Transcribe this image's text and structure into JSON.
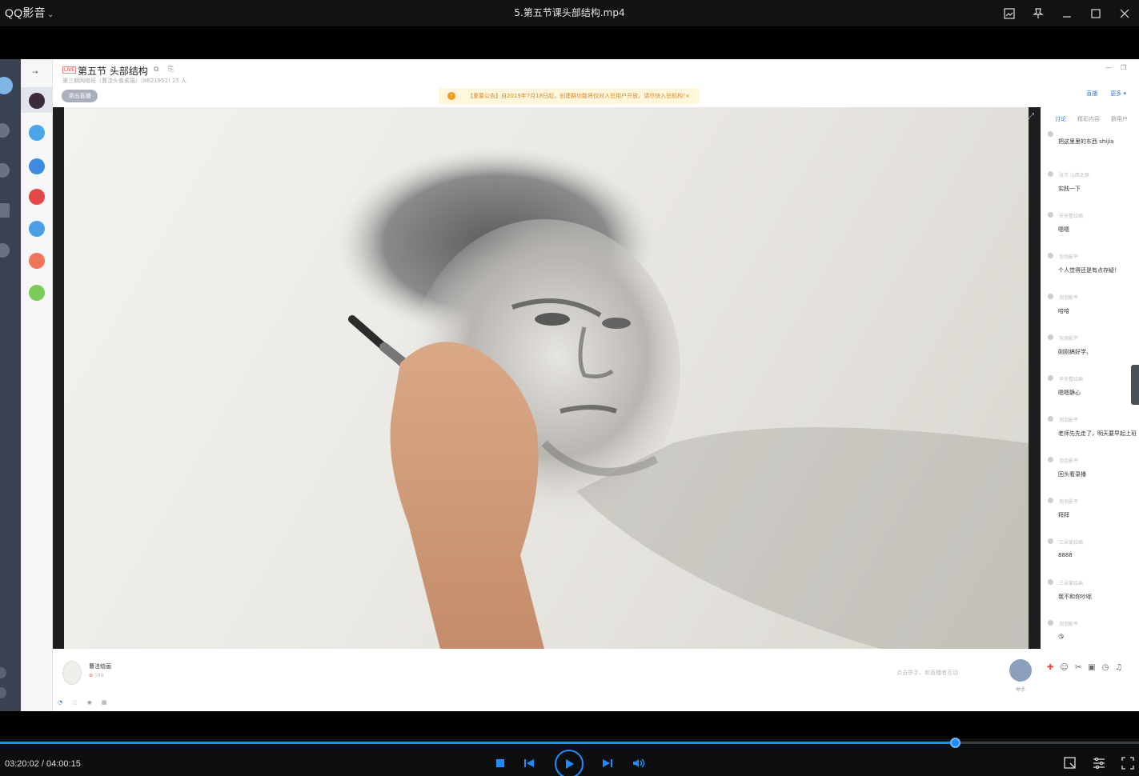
{
  "window": {
    "app_name": "QQ影音",
    "file_title": "5.第五节课头部结构.mp4"
  },
  "recorded_app": {
    "live_tag": "LIVE",
    "course_title": "第五节 头部结构",
    "subtitle": "第三期网络班（曹洼头像素描）(8621952)  25 人",
    "exit_button": "退出直播",
    "notice": "【重要公告】自2019年7月18日起，创建群功能将仅对入驻用户开放，请尽快入驻机构！",
    "top_links": [
      "直播",
      "更多 ▾"
    ],
    "chat_tabs": [
      "讨论",
      "精彩内容",
      "群用户"
    ],
    "messages": [
      {
        "user": "",
        "text": "把这里里的东西 shijia"
      },
      {
        "user": "张芳 山西太原",
        "text": "实践一下"
      },
      {
        "user": "天天看绘画",
        "text": "嗯嗯"
      },
      {
        "user": "泡泡影平",
        "text": "个人觉得还是有点存疑！"
      },
      {
        "user": "泡泡影平",
        "text": "哈哈"
      },
      {
        "user": "泡泡影平",
        "text": "刚刚搞好学。"
      },
      {
        "user": "天天看绘画",
        "text": "嗯嗯静心"
      },
      {
        "user": "泡泡影平",
        "text": "老师先先走了，明天要早起上班"
      },
      {
        "user": "泡泡影平",
        "text": "回头看录播"
      },
      {
        "user": "泡泡影平",
        "text": "拜拜"
      },
      {
        "user": "三朵爱绘画",
        "text": "8888"
      },
      {
        "user": "三朵爱绘画",
        "text": "我不和你吵呢"
      },
      {
        "user": "泡泡影平",
        "text": "😘"
      }
    ],
    "host_name": "曹洼绘画",
    "host_likes": "189",
    "hint": "点击举手，和直播者互动",
    "raise_hand_label": "举手"
  },
  "player": {
    "current_time": "03:20:02",
    "total_time": "04:00:15",
    "time_display": "03:20:02 / 04:00:15",
    "progress": 0.8385
  },
  "colors": {
    "accent": "#1e8cff",
    "titlebar": "#101214"
  }
}
